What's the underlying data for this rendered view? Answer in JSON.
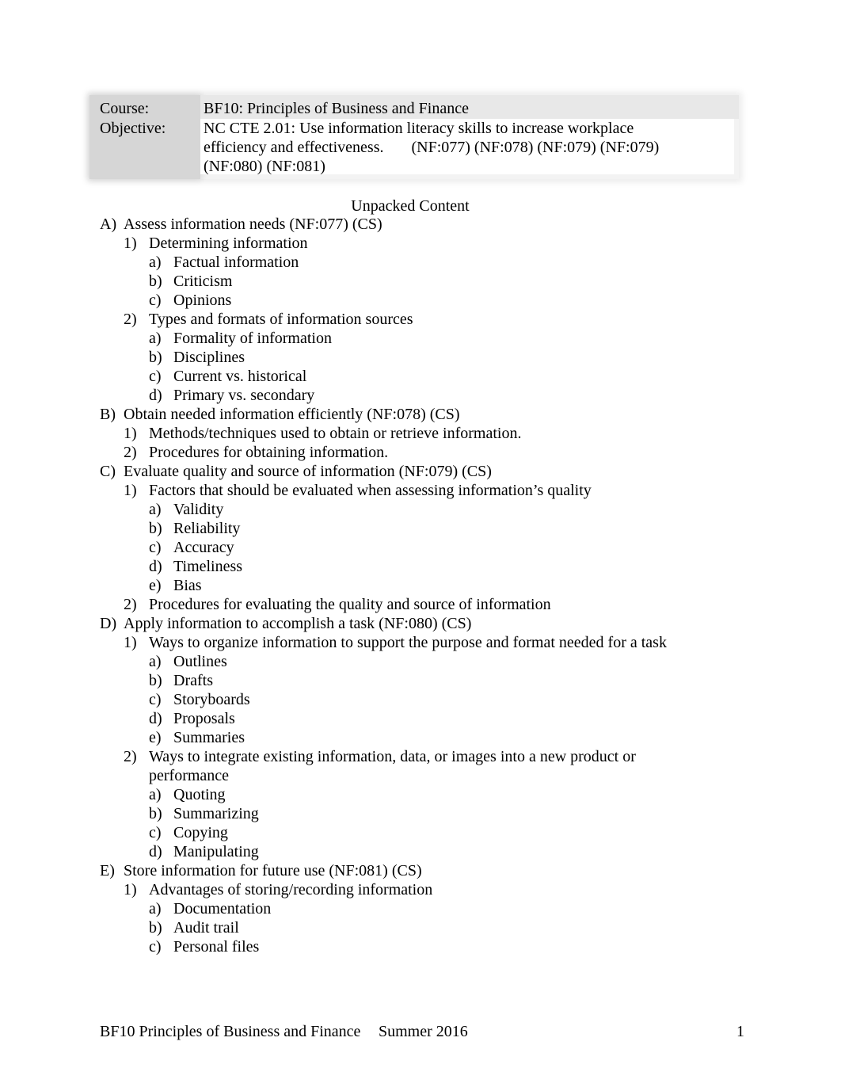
{
  "header": {
    "course_label": "Course:",
    "course_value": "BF10: Principles of Business and Finance",
    "objective_label": "Objective:",
    "objective_line1": "NC CTE 2.01: Use information literacy skills to increase workplace",
    "objective_line2": "efficiency and effectiveness.       (NF:077) (NF:078) (NF:079) (NF:079)",
    "objective_line3": "(NF:080) (NF:081)"
  },
  "title": "Unpacked Content",
  "outline": [
    {
      "level": 1,
      "marker": "A)",
      "text": "Assess information needs (NF:077) (CS)"
    },
    {
      "level": 2,
      "marker": "1)",
      "text": "Determining information"
    },
    {
      "level": 3,
      "marker": "a)",
      "text": "Factual information"
    },
    {
      "level": 3,
      "marker": "b)",
      "text": "Criticism"
    },
    {
      "level": 3,
      "marker": "c)",
      "text": "Opinions"
    },
    {
      "level": 2,
      "marker": "2)",
      "text": "Types and formats of information sources"
    },
    {
      "level": 3,
      "marker": "a)",
      "text": "Formality of information"
    },
    {
      "level": 3,
      "marker": "b)",
      "text": "Disciplines"
    },
    {
      "level": 3,
      "marker": "c)",
      "text": "Current vs. historical"
    },
    {
      "level": 3,
      "marker": "d)",
      "text": "Primary vs. secondary"
    },
    {
      "level": 1,
      "marker": "B)",
      "text": "Obtain needed information efficiently (NF:078) (CS)"
    },
    {
      "level": 2,
      "marker": "1)",
      "text": "Methods/techniques used to obtain or retrieve information."
    },
    {
      "level": 2,
      "marker": "2)",
      "text": "Procedures for obtaining information."
    },
    {
      "level": 1,
      "marker": "C)",
      "text": "Evaluate quality and source of information (NF:079) (CS)"
    },
    {
      "level": 2,
      "marker": "1)",
      "text": "Factors that should be evaluated when assessing information’s quality"
    },
    {
      "level": 3,
      "marker": "a)",
      "text": "Validity"
    },
    {
      "level": 3,
      "marker": "b)",
      "text": "Reliability"
    },
    {
      "level": 3,
      "marker": "c)",
      "text": "Accuracy"
    },
    {
      "level": 3,
      "marker": "d)",
      "text": "Timeliness"
    },
    {
      "level": 3,
      "marker": "e)",
      "text": "Bias"
    },
    {
      "level": 2,
      "marker": "2)",
      "text": "Procedures for evaluating the quality and source of information"
    },
    {
      "level": 1,
      "marker": "D)",
      "text": "Apply information to accomplish a task (NF:080) (CS)"
    },
    {
      "level": 2,
      "marker": "1)",
      "text": "Ways to organize information to support the purpose and format needed for a task"
    },
    {
      "level": 3,
      "marker": "a)",
      "text": "Outlines"
    },
    {
      "level": 3,
      "marker": "b)",
      "text": "Drafts"
    },
    {
      "level": 3,
      "marker": "c)",
      "text": "Storyboards"
    },
    {
      "level": 3,
      "marker": "d)",
      "text": "Proposals"
    },
    {
      "level": 3,
      "marker": "e)",
      "text": "Summaries"
    },
    {
      "level": 2,
      "marker": "2)",
      "text": "Ways to integrate existing information, data, or images into a new product or performance"
    },
    {
      "level": 3,
      "marker": "a)",
      "text": "Quoting"
    },
    {
      "level": 3,
      "marker": "b)",
      "text": "Summarizing"
    },
    {
      "level": 3,
      "marker": "c)",
      "text": "Copying"
    },
    {
      "level": 3,
      "marker": "d)",
      "text": "Manipulating"
    },
    {
      "level": 1,
      "marker": "E)",
      "text": "Store information for future use (NF:081) (CS)"
    },
    {
      "level": 2,
      "marker": "1)",
      "text": "Advantages of storing/recording information"
    },
    {
      "level": 3,
      "marker": "a)",
      "text": "Documentation"
    },
    {
      "level": 3,
      "marker": "b)",
      "text": "Audit trail"
    },
    {
      "level": 3,
      "marker": "c)",
      "text": "Personal files"
    }
  ],
  "footer": {
    "course": "BF10 Principles of Business and Finance",
    "term": "Summer 2016",
    "page_number": "1"
  }
}
